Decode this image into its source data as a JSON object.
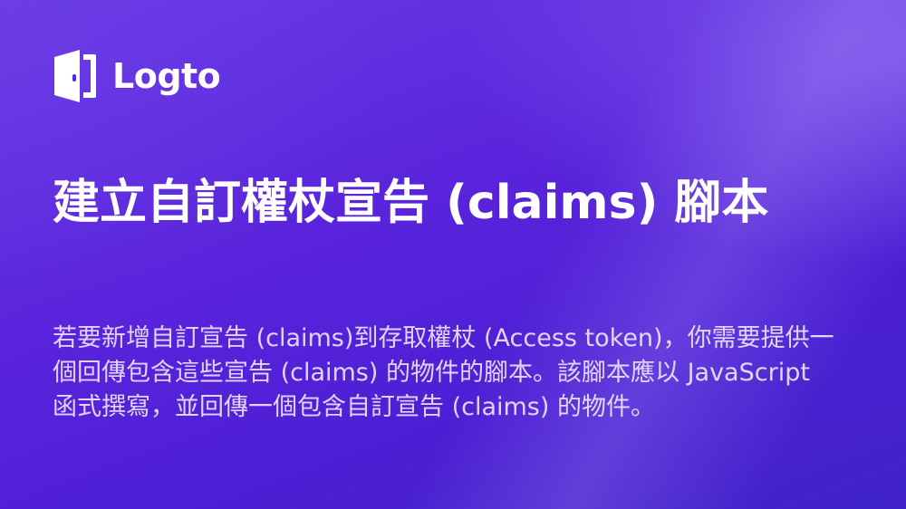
{
  "brand": {
    "logo_icon": "logto-door-icon",
    "name": "Logto"
  },
  "article": {
    "title": "建立自訂權杖宣告 (claims) 腳本",
    "description": "若要新增自訂宣告 (claims)到存取權杖 (Access token)，你需要提供一個回傳包含這些宣告 (claims) 的物件的腳本。該腳本應以 JavaScript 函式撰寫，並回傳一個包含自訂宣告 (claims) 的物件。"
  },
  "colors": {
    "background": "#5b1fd6",
    "text": "#ffffff"
  }
}
